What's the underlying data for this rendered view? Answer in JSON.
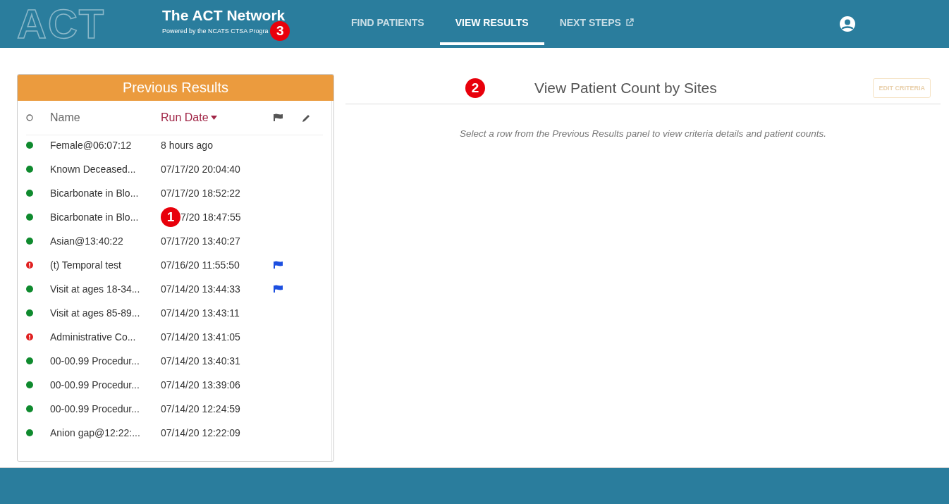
{
  "header": {
    "logo": "ACT",
    "title": "The ACT Network",
    "subtitle": "Powered by the NCATS CTSA Progra",
    "subtitle_callout": "3",
    "nav": [
      {
        "label": "FIND PATIENTS",
        "selected": false,
        "external": false
      },
      {
        "label": "VIEW RESULTS",
        "selected": true,
        "external": false
      },
      {
        "label": "NEXT STEPS",
        "selected": false,
        "external": true
      }
    ]
  },
  "previous_results": {
    "title": "Previous Results",
    "select_all": {
      "checked": false
    },
    "columns": {
      "name": "Name",
      "run_date": "Run Date"
    },
    "rows": [
      {
        "error": false,
        "name": "Female@06:07:12",
        "run_date": "8 hours ago",
        "flagged": false
      },
      {
        "error": false,
        "name": "Known Deceased...",
        "run_date": "07/17/20 20:04:40",
        "flagged": false
      },
      {
        "error": false,
        "name": "Bicarbonate in Blo...",
        "run_date": "07/17/20 18:52:22",
        "flagged": false
      },
      {
        "error": false,
        "name": "Bicarbonate in Blo...",
        "callout": "1",
        "run_date": "7/20 18:47:55",
        "flagged": false
      },
      {
        "error": false,
        "name": "Asian@13:40:22",
        "run_date": "07/17/20 13:40:27",
        "flagged": false
      },
      {
        "error": true,
        "name": "(t) Temporal test",
        "run_date": "07/16/20 11:55:50",
        "flagged": true
      },
      {
        "error": false,
        "name": "Visit at ages 18-34...",
        "run_date": "07/14/20 13:44:33",
        "flagged": true
      },
      {
        "error": false,
        "name": "Visit at ages 85-89...",
        "run_date": "07/14/20 13:43:11",
        "flagged": false
      },
      {
        "error": true,
        "name": "Administrative Co...",
        "run_date": "07/14/20 13:41:05",
        "flagged": false
      },
      {
        "error": false,
        "name": "00-00.99 Procedur...",
        "run_date": "07/14/20 13:40:31",
        "flagged": false
      },
      {
        "error": false,
        "name": "00-00.99 Procedur...",
        "run_date": "07/14/20 13:39:06",
        "flagged": false
      },
      {
        "error": false,
        "name": "00-00.99 Procedur...",
        "run_date": "07/14/20 12:24:59",
        "flagged": false
      },
      {
        "error": false,
        "name": "Anion gap@12:22:...",
        "run_date": "07/14/20 12:22:09",
        "flagged": false
      }
    ]
  },
  "view": {
    "callout": "2",
    "title": "View Patient Count by Sites",
    "edit_button": {
      "label": "EDIT CRITERIA",
      "disabled": true
    },
    "message": "Select a row from the Previous Results panel to view criteria details and patient counts."
  }
}
